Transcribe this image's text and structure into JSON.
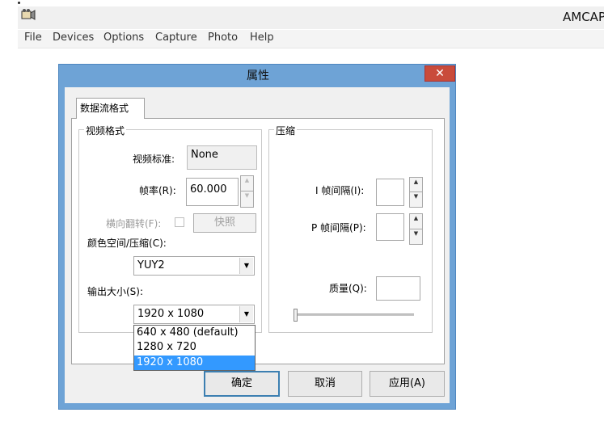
{
  "app": {
    "title": "AMCAP",
    "menu": [
      "File",
      "Devices",
      "Options",
      "Capture",
      "Photo",
      "Help"
    ]
  },
  "dialog": {
    "title": "属性",
    "close_label": "✕",
    "tab_label": "数据流格式",
    "video_format": {
      "group_label": "视频格式",
      "standard_label": "视频标准:",
      "standard_value": "None",
      "framerate_label": "帧率(R):",
      "framerate_value": "60.000",
      "flip_label": "横向翻转(F):",
      "snapshot_label": "快照",
      "colorspace_label": "颜色空间/压缩(C):",
      "colorspace_value": "YUY2",
      "output_size_label": "输出大小(S):",
      "output_size_value": "1920 x 1080",
      "output_size_options": [
        "640 x 480  (default)",
        "1280 x 720",
        "1920 x 1080"
      ],
      "output_size_selected_index": 2
    },
    "compression": {
      "group_label": "压缩",
      "i_frame_label": "I 帧间隔(I):",
      "i_frame_value": "",
      "p_frame_label": "P 帧间隔(P):",
      "p_frame_value": "",
      "quality_label": "质量(Q):",
      "quality_value": ""
    },
    "buttons": {
      "ok": "确定",
      "cancel": "取消",
      "apply": "应用(A)"
    }
  },
  "colors": {
    "dialog_frame": "#6ea3d6",
    "close_button": "#c94b3b",
    "selection": "#3399ff"
  }
}
